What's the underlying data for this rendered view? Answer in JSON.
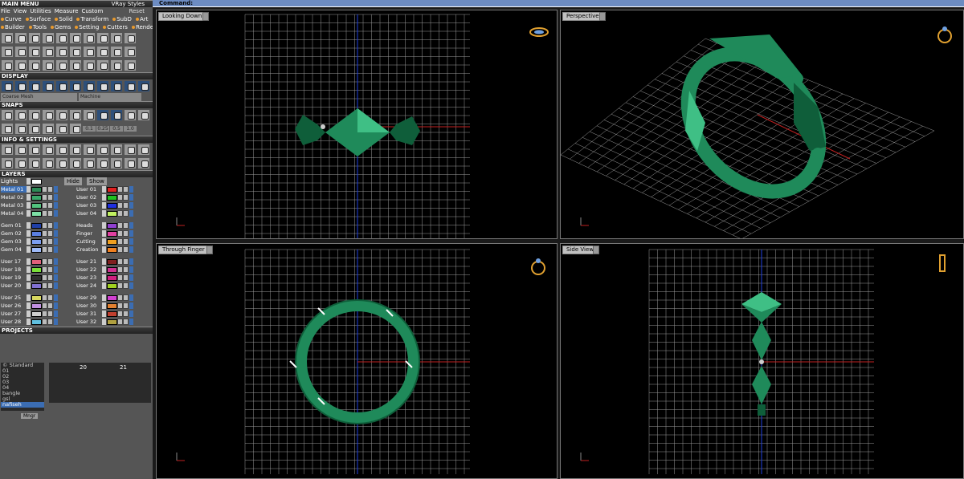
{
  "menu": {
    "title": "MAIN MENU",
    "style": "VRay Styles",
    "items": [
      "File",
      "View",
      "Utilities",
      "Measure",
      "Custom"
    ],
    "reset": "Reset",
    "categories": [
      {
        "label": "Curve",
        "color": "#e89a2e"
      },
      {
        "label": "Surface",
        "color": "#e89a2e"
      },
      {
        "label": "Solid",
        "color": "#e89a2e"
      },
      {
        "label": "Transform",
        "color": "#e89a2e"
      },
      {
        "label": "SubD",
        "color": "#e89a2e"
      },
      {
        "label": "Art",
        "color": "#e89a2e"
      },
      {
        "label": "Builder",
        "color": "#e89a2e"
      },
      {
        "label": "Tools",
        "color": "#e89a2e"
      },
      {
        "label": "Gems",
        "color": "#e89a2e"
      },
      {
        "label": "Setting",
        "color": "#e89a2e"
      },
      {
        "label": "Cutters",
        "color": "#e89a2e"
      },
      {
        "label": "Render",
        "color": "#e89a2e"
      }
    ]
  },
  "display": {
    "title": "DISPLAY",
    "mesh": "Coarse Mesh",
    "material": "Machine"
  },
  "snaps": {
    "title": "SNAPS",
    "values": [
      "0.1",
      "0.25",
      "0.5",
      "1.0"
    ]
  },
  "info": {
    "title": "INFO & SETTINGS"
  },
  "layers": {
    "title": "LAYERS",
    "lights": "Lights",
    "hide": "Hide",
    "show": "Show",
    "left": [
      {
        "name": "Metal 01",
        "color": "#2e8b57",
        "selected": true
      },
      {
        "name": "Metal 02",
        "color": "#3aa86a"
      },
      {
        "name": "Metal 03",
        "color": "#52c27e"
      },
      {
        "name": "Metal 04",
        "color": "#7de0a6"
      },
      {
        "name": "Gem 01",
        "color": "#1f3fa8"
      },
      {
        "name": "Gem 02",
        "color": "#5b7fe0"
      },
      {
        "name": "Gem 03",
        "color": "#7c9ef0"
      },
      {
        "name": "Gem 04",
        "color": "#9fbaf8"
      },
      {
        "name": "User 17",
        "color": "#e0607a"
      },
      {
        "name": "User 18",
        "color": "#7ae03a"
      },
      {
        "name": "User 19",
        "color": "#303030"
      },
      {
        "name": "User 20",
        "color": "#8070d0"
      },
      {
        "name": "User 25",
        "color": "#d8d860"
      },
      {
        "name": "User 26",
        "color": "#c090e0"
      },
      {
        "name": "User 27",
        "color": "#d0d0d0"
      },
      {
        "name": "User 28",
        "color": "#60c0e0"
      }
    ],
    "right": [
      {
        "name": "User 01",
        "color": "#e02020"
      },
      {
        "name": "User 02",
        "color": "#20c020"
      },
      {
        "name": "User 03",
        "color": "#2030e0"
      },
      {
        "name": "User 04",
        "color": "#c0f060"
      },
      {
        "name": "Heads",
        "color": "#9040d0"
      },
      {
        "name": "Finger",
        "color": "#e040a0"
      },
      {
        "name": "Cutting",
        "color": "#f0a020"
      },
      {
        "name": "Creation",
        "color": "#f08020"
      },
      {
        "name": "User 21",
        "color": "#802020"
      },
      {
        "name": "User 22",
        "color": "#d03090"
      },
      {
        "name": "User 23",
        "color": "#d02080"
      },
      {
        "name": "User 24",
        "color": "#a0d020"
      },
      {
        "name": "User 29",
        "color": "#d040d0"
      },
      {
        "name": "User 30",
        "color": "#e08030"
      },
      {
        "name": "User 31",
        "color": "#c04030"
      },
      {
        "name": "User 32",
        "color": "#b0a040"
      }
    ]
  },
  "projects": {
    "title": "PROJECTS",
    "list": [
      "© Standard",
      "01",
      "02",
      "03",
      "04",
      "bangle",
      "gsl",
      "nafiseh"
    ],
    "selected": "nafiseh",
    "slots": [
      "20",
      "21"
    ],
    "mngr": "Mngr"
  },
  "command": {
    "label": "Command:"
  },
  "viewports": [
    {
      "label": "Looking Down",
      "icon": "ring-top-icon"
    },
    {
      "label": "Perspective",
      "icon": "ring-perspective-icon"
    },
    {
      "label": "Through Finger",
      "icon": "ring-front-icon"
    },
    {
      "label": "Side View",
      "icon": "ring-side-icon"
    }
  ],
  "colors": {
    "model": "#1f8a5a",
    "model_dark": "#0f5e3a",
    "model_light": "#3fbf85",
    "grid": "#9a9a9a",
    "axis_red": "#c02020",
    "axis_blue": "#2040e0",
    "accent": "#3b6db3"
  }
}
